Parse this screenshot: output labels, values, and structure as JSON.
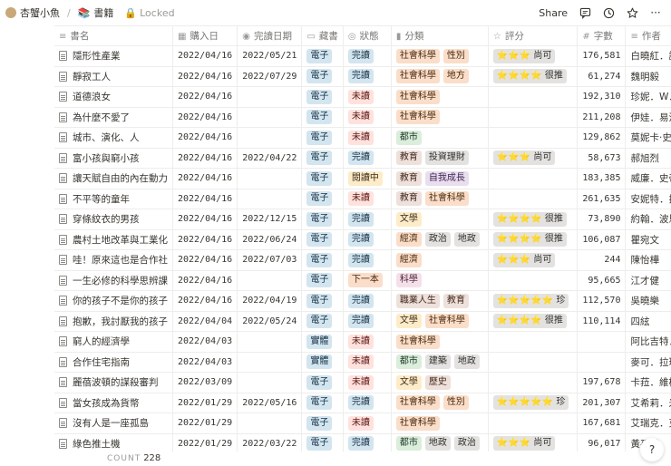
{
  "breadcrumb": {
    "workspace": "杏蟹小魚",
    "page": "書籍",
    "locked": "Locked"
  },
  "topbar": {
    "share": "Share"
  },
  "columns": [
    {
      "label": "書名",
      "icon": "text-icon"
    },
    {
      "label": "購入日",
      "icon": "calendar-icon"
    },
    {
      "label": "完讀日期",
      "icon": "check-circle-icon"
    },
    {
      "label": "藏書",
      "icon": "book-icon"
    },
    {
      "label": "狀態",
      "icon": "select-icon"
    },
    {
      "label": "分類",
      "icon": "tag-icon"
    },
    {
      "label": "評分",
      "icon": "star-icon"
    },
    {
      "label": "字數",
      "icon": "hash-icon"
    },
    {
      "label": "作者",
      "icon": "text-icon"
    }
  ],
  "rows": [
    {
      "title": "隱形性產業",
      "bought": "2022/04/16",
      "finished": "2022/05/21",
      "format": "電子",
      "status": "完讀",
      "cats": [
        {
          "t": "社會科學",
          "c": "orange"
        },
        {
          "t": "性別",
          "c": "orange"
        }
      ],
      "rating": "⭐⭐⭐ 尚可",
      "words": "176,581",
      "author": "白曉紅．譯者"
    },
    {
      "title": "靜寂工人",
      "bought": "2022/04/16",
      "finished": "2022/07/29",
      "format": "電子",
      "status": "完讀",
      "cats": [
        {
          "t": "社會科學",
          "c": "orange"
        },
        {
          "t": "地方",
          "c": "orange"
        }
      ],
      "rating": "⭐⭐⭐⭐ 很推",
      "words": "61,274",
      "author": "魏明毅"
    },
    {
      "title": "道德浪女",
      "bought": "2022/04/16",
      "finished": "",
      "format": "電子",
      "status": "未讀",
      "cats": [
        {
          "t": "社會科學",
          "c": "orange"
        }
      ],
      "rating": "",
      "words": "192,310",
      "author": "珍妮．W．哈迪"
    },
    {
      "title": "為什麼不愛了",
      "bought": "2022/04/16",
      "finished": "",
      "format": "電子",
      "status": "未讀",
      "cats": [
        {
          "t": "社會科學",
          "c": "orange"
        }
      ],
      "rating": "",
      "words": "211,208",
      "author": "伊娃．易洛斯"
    },
    {
      "title": "城市、演化、人",
      "bought": "2022/04/16",
      "finished": "",
      "format": "電子",
      "status": "未讀",
      "cats": [
        {
          "t": "都市",
          "c": "green"
        }
      ],
      "rating": "",
      "words": "129,862",
      "author": "莫妮卡·史密斯"
    },
    {
      "title": "富小孩與窮小孩",
      "bought": "2022/04/16",
      "finished": "2022/04/22",
      "format": "電子",
      "status": "完讀",
      "cats": [
        {
          "t": "教育",
          "c": "brown"
        },
        {
          "t": "投資理財",
          "c": "gray"
        }
      ],
      "rating": "⭐⭐⭐ 尚可",
      "words": "58,673",
      "author": "郝旭烈"
    },
    {
      "title": "讓天賦自由的內在動力",
      "bought": "2022/04/16",
      "finished": "",
      "format": "電子",
      "status": "閱讀中",
      "cats": [
        {
          "t": "教育",
          "c": "brown"
        },
        {
          "t": "自我成長",
          "c": "purple"
        }
      ],
      "rating": "",
      "words": "183,385",
      "author": "威廉．史帝爾"
    },
    {
      "title": "不平等的童年",
      "bought": "2022/04/16",
      "finished": "",
      "format": "電子",
      "status": "未讀",
      "cats": [
        {
          "t": "教育",
          "c": "brown"
        },
        {
          "t": "社會科學",
          "c": "orange"
        }
      ],
      "rating": "",
      "words": "261,635",
      "author": "安妮特．拉蘿"
    },
    {
      "title": "穿條紋衣的男孩",
      "bought": "2022/04/16",
      "finished": "2022/12/15",
      "format": "電子",
      "status": "完讀",
      "cats": [
        {
          "t": "文學",
          "c": "yellow"
        }
      ],
      "rating": "⭐⭐⭐⭐ 很推",
      "words": "73,890",
      "author": "約翰．波恩John"
    },
    {
      "title": "農村土地改革與工業化",
      "bought": "2022/04/16",
      "finished": "2022/06/24",
      "format": "電子",
      "status": "完讀",
      "cats": [
        {
          "t": "經濟",
          "c": "orange"
        },
        {
          "t": "政治",
          "c": "gray"
        },
        {
          "t": "地政",
          "c": "gray"
        }
      ],
      "rating": "⭐⭐⭐⭐ 很推",
      "words": "106,087",
      "author": "瞿宛文"
    },
    {
      "title": "哇！原來這也是合作社",
      "bought": "2022/04/16",
      "finished": "2022/07/03",
      "format": "電子",
      "status": "完讀",
      "cats": [
        {
          "t": "經濟",
          "c": "orange"
        }
      ],
      "rating": "⭐⭐⭐ 尚可",
      "words": "244",
      "author": "陳怡樺"
    },
    {
      "title": "一生必修的科學思辨課",
      "bought": "2022/04/16",
      "finished": "",
      "format": "電子",
      "status": "下一本",
      "cats": [
        {
          "t": "科學",
          "c": "pink"
        }
      ],
      "rating": "",
      "words": "95,665",
      "author": "江才健"
    },
    {
      "title": "你的孩子不是你的孩子",
      "bought": "2022/04/16",
      "finished": "2022/04/19",
      "format": "電子",
      "status": "完讀",
      "cats": [
        {
          "t": "職業人生",
          "c": "brown"
        },
        {
          "t": "教育",
          "c": "brown"
        }
      ],
      "rating": "⭐⭐⭐⭐⭐ 珍",
      "words": "112,570",
      "author": "吳曉樂"
    },
    {
      "title": "抱歉，我討厭我的孩子",
      "bought": "2022/04/04",
      "finished": "2022/05/24",
      "format": "電子",
      "status": "完讀",
      "cats": [
        {
          "t": "文學",
          "c": "yellow"
        },
        {
          "t": "社會科學",
          "c": "orange"
        }
      ],
      "rating": "⭐⭐⭐⭐ 很推",
      "words": "110,114",
      "author": "四絃"
    },
    {
      "title": "窮人的經濟學",
      "bought": "2022/04/03",
      "finished": "",
      "format": "實體",
      "status": "未讀",
      "cats": [
        {
          "t": "社會科學",
          "c": "orange"
        }
      ],
      "rating": "",
      "words": "",
      "author": "阿比吉特．班納"
    },
    {
      "title": "合作住宅指南",
      "bought": "2022/04/03",
      "finished": "",
      "format": "實體",
      "status": "未讀",
      "cats": [
        {
          "t": "都市",
          "c": "green"
        },
        {
          "t": "建築",
          "c": "gray"
        },
        {
          "t": "地政",
          "c": "gray"
        }
      ],
      "rating": "",
      "words": "",
      "author": "麥可．拉瑪德McC"
    },
    {
      "title": "麗蓓波頓的謀殺審判",
      "bought": "2022/03/09",
      "finished": "",
      "format": "電子",
      "status": "未讀",
      "cats": [
        {
          "t": "文學",
          "c": "yellow"
        },
        {
          "t": "歷史",
          "c": "brown"
        }
      ],
      "rating": "",
      "words": "197,678",
      "author": "卡菈．維柏森"
    },
    {
      "title": "當女孩成為貨幣",
      "bought": "2022/01/29",
      "finished": "2022/05/16",
      "format": "電子",
      "status": "完讀",
      "cats": [
        {
          "t": "社會科學",
          "c": "orange"
        },
        {
          "t": "性別",
          "c": "orange"
        }
      ],
      "rating": "⭐⭐⭐⭐⭐ 珍",
      "words": "201,307",
      "author": "艾希莉．米爾斯"
    },
    {
      "title": "沒有人是一座孤島",
      "bought": "2022/01/29",
      "finished": "",
      "format": "電子",
      "status": "未讀",
      "cats": [
        {
          "t": "社會科學",
          "c": "orange"
        }
      ],
      "rating": "",
      "words": "167,681",
      "author": "艾瑞克．克林南"
    },
    {
      "title": "綠色推土機",
      "bought": "2022/01/29",
      "finished": "2022/03/22",
      "format": "電子",
      "status": "完讀",
      "cats": [
        {
          "t": "都市",
          "c": "green"
        },
        {
          "t": "地政",
          "c": "gray"
        },
        {
          "t": "政治",
          "c": "gray"
        }
      ],
      "rating": "⭐⭐⭐ 尚可",
      "words": "96,017",
      "author": "黃孫權"
    }
  ],
  "footer": {
    "count_label": "COUNT",
    "count_value": "228"
  },
  "colors": {
    "status": {
      "完讀": "blue",
      "未讀": "red",
      "閱讀中": "yellow",
      "下一本": "orange"
    }
  }
}
